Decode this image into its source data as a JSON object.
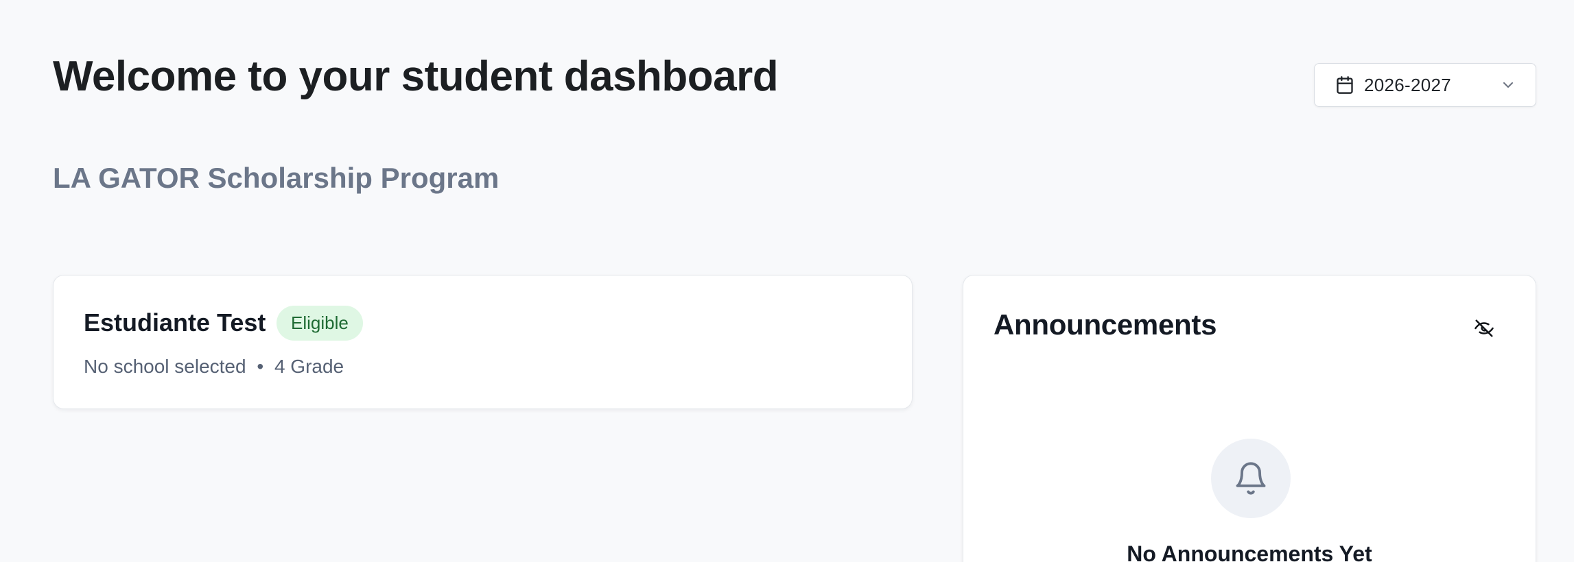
{
  "header": {
    "title": "Welcome to your student dashboard",
    "program": "LA GATOR Scholarship Program"
  },
  "year_select": {
    "value": "2026-2027",
    "icon": "calendar-icon",
    "chevron_icon": "chevron-down-icon"
  },
  "student": {
    "name": "Estudiante Test",
    "status": "Eligible",
    "school": "No school selected",
    "separator": "•",
    "grade": "4 Grade"
  },
  "announcements": {
    "title": "Announcements",
    "toggle_icon": "eye-off-icon",
    "empty_icon": "bell-icon",
    "empty_title": "No Announcements Yet"
  },
  "colors": {
    "background": "#f8f9fb",
    "badge_bg": "#dff7e4",
    "badge_text": "#1f6b34",
    "subtitle": "#6b7689"
  }
}
